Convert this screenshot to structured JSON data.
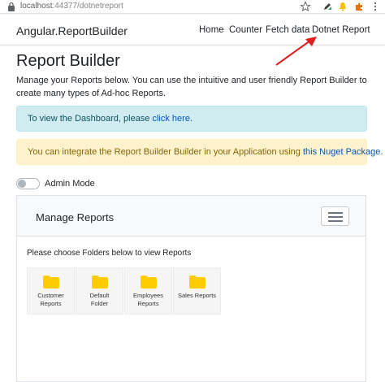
{
  "browser": {
    "url_host": "localhost",
    "url_rest": ":44377/dotnetreport"
  },
  "navbar": {
    "brand": "Angular.ReportBuilder",
    "links": [
      "Home",
      "Counter",
      "Fetch data",
      "Dotnet Report"
    ]
  },
  "page": {
    "title": "Report Builder",
    "intro": "Manage your Reports below. You can use the intuitive and user friendly Report Builder to create many types of Ad-hoc Reports."
  },
  "alerts": {
    "info_text": "To view the Dashboard, please ",
    "info_link": "click here",
    "info_end": ".",
    "warning_text": "You can integrate the Report Builder Builder in your Application using ",
    "warning_link": "this Nuget Package",
    "warning_end": "."
  },
  "admin_mode": {
    "label": "Admin Mode",
    "enabled": false
  },
  "panel": {
    "title": "Manage Reports",
    "hint": "Please choose Folders below to view Reports",
    "folders": [
      {
        "line1": "Customer",
        "line2": "Reports"
      },
      {
        "line1": "Default",
        "line2": "Folder"
      },
      {
        "line1": "Employees",
        "line2": "Reports"
      },
      {
        "line1": "Sales Reports",
        "line2": ""
      }
    ]
  },
  "colors": {
    "folder": "#ffcc00",
    "arrow": "#e02020",
    "link": "#0056b3"
  }
}
